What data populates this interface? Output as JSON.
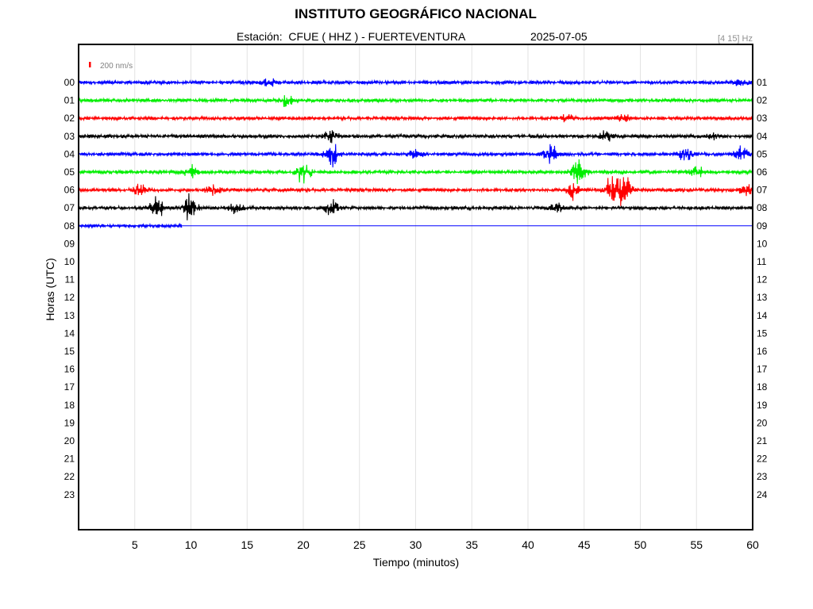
{
  "header": {
    "title": "INSTITUTO GEOGRÁFICO NACIONAL",
    "station_line": "Estación:  CFUE ( HHZ ) - FUERTEVENTURA",
    "date": "2025-07-05",
    "filter": "[4 15] Hz"
  },
  "scale": {
    "label": "200 nm/s",
    "color": "#ff0000"
  },
  "chart_data": {
    "type": "line",
    "title": "INSTITUTO GEOGRÁFICO NACIONAL",
    "subtitle": "Estación:  CFUE ( HHZ ) - FUERTEVENTURA",
    "xlabel": "Tiempo (minutos)",
    "ylabel": "Horas (UTC)",
    "xlim": [
      0,
      60
    ],
    "x_ticks": [
      5,
      10,
      15,
      20,
      25,
      30,
      35,
      40,
      45,
      50,
      55,
      60
    ],
    "left_hour_labels": [
      "00",
      "01",
      "02",
      "03",
      "04",
      "05",
      "06",
      "07",
      "08",
      "09",
      "10",
      "11",
      "12",
      "13",
      "14",
      "15",
      "16",
      "17",
      "18",
      "19",
      "20",
      "21",
      "22",
      "23"
    ],
    "right_hour_labels": [
      "01",
      "02",
      "03",
      "04",
      "05",
      "06",
      "07",
      "08",
      "09",
      "10",
      "11",
      "12",
      "13",
      "14",
      "15",
      "16",
      "17",
      "18",
      "19",
      "20",
      "21",
      "22",
      "23",
      "24"
    ],
    "grid": "vertical",
    "trace_colors": [
      "#0000ff",
      "#00ee00",
      "#ff0000",
      "#000000"
    ],
    "series": [
      {
        "hour": "00",
        "color": "#0000ff",
        "end_minute": 60,
        "bursts": [
          [
            17.0,
            6
          ],
          [
            59.0,
            4
          ]
        ]
      },
      {
        "hour": "01",
        "color": "#00ee00",
        "end_minute": 60,
        "bursts": [
          [
            18.5,
            7
          ]
        ]
      },
      {
        "hour": "02",
        "color": "#ff0000",
        "end_minute": 60,
        "bursts": [
          [
            43.5,
            5
          ],
          [
            48.5,
            5
          ]
        ]
      },
      {
        "hour": "03",
        "color": "#000000",
        "end_minute": 60,
        "bursts": [
          [
            22.5,
            11
          ],
          [
            47.0,
            6
          ],
          [
            56.5,
            4
          ]
        ]
      },
      {
        "hour": "04",
        "color": "#0000ff",
        "end_minute": 60,
        "bursts": [
          [
            22.5,
            18
          ],
          [
            30.0,
            6
          ],
          [
            42.0,
            14
          ],
          [
            54.0,
            8
          ],
          [
            59.0,
            10
          ]
        ]
      },
      {
        "hour": "05",
        "color": "#00ee00",
        "end_minute": 60,
        "bursts": [
          [
            10.0,
            8
          ],
          [
            20.0,
            14
          ],
          [
            44.5,
            16
          ],
          [
            55.0,
            8
          ]
        ]
      },
      {
        "hour": "06",
        "color": "#ff0000",
        "end_minute": 60,
        "bursts": [
          [
            5.5,
            8
          ],
          [
            12.0,
            8
          ],
          [
            44.0,
            10
          ],
          [
            47.5,
            20
          ],
          [
            48.5,
            24
          ],
          [
            59.5,
            8
          ]
        ]
      },
      {
        "hour": "07",
        "color": "#000000",
        "end_minute": 60,
        "bursts": [
          [
            7.0,
            14
          ],
          [
            10.0,
            16
          ],
          [
            14.0,
            8
          ],
          [
            22.5,
            9
          ],
          [
            42.5,
            6
          ]
        ]
      },
      {
        "hour": "08",
        "color": "#0000ff",
        "end_minute": 9.2,
        "bursts": []
      }
    ]
  }
}
